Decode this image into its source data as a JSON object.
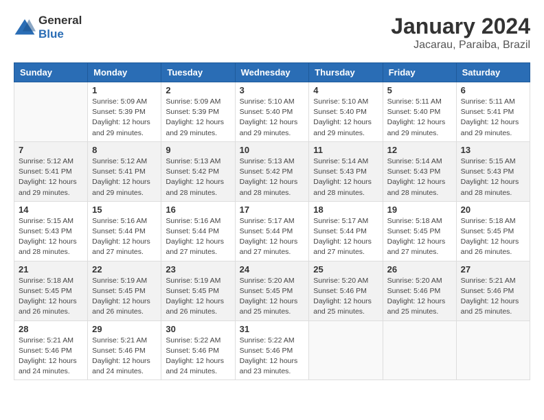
{
  "logo": {
    "text_general": "General",
    "text_blue": "Blue"
  },
  "title": "January 2024",
  "subtitle": "Jacarau, Paraiba, Brazil",
  "days_of_week": [
    "Sunday",
    "Monday",
    "Tuesday",
    "Wednesday",
    "Thursday",
    "Friday",
    "Saturday"
  ],
  "weeks": [
    [
      {
        "day": "",
        "info": ""
      },
      {
        "day": "1",
        "info": "Sunrise: 5:09 AM\nSunset: 5:39 PM\nDaylight: 12 hours\nand 29 minutes."
      },
      {
        "day": "2",
        "info": "Sunrise: 5:09 AM\nSunset: 5:39 PM\nDaylight: 12 hours\nand 29 minutes."
      },
      {
        "day": "3",
        "info": "Sunrise: 5:10 AM\nSunset: 5:40 PM\nDaylight: 12 hours\nand 29 minutes."
      },
      {
        "day": "4",
        "info": "Sunrise: 5:10 AM\nSunset: 5:40 PM\nDaylight: 12 hours\nand 29 minutes."
      },
      {
        "day": "5",
        "info": "Sunrise: 5:11 AM\nSunset: 5:40 PM\nDaylight: 12 hours\nand 29 minutes."
      },
      {
        "day": "6",
        "info": "Sunrise: 5:11 AM\nSunset: 5:41 PM\nDaylight: 12 hours\nand 29 minutes."
      }
    ],
    [
      {
        "day": "7",
        "info": "Sunrise: 5:12 AM\nSunset: 5:41 PM\nDaylight: 12 hours\nand 29 minutes."
      },
      {
        "day": "8",
        "info": "Sunrise: 5:12 AM\nSunset: 5:41 PM\nDaylight: 12 hours\nand 29 minutes."
      },
      {
        "day": "9",
        "info": "Sunrise: 5:13 AM\nSunset: 5:42 PM\nDaylight: 12 hours\nand 28 minutes."
      },
      {
        "day": "10",
        "info": "Sunrise: 5:13 AM\nSunset: 5:42 PM\nDaylight: 12 hours\nand 28 minutes."
      },
      {
        "day": "11",
        "info": "Sunrise: 5:14 AM\nSunset: 5:43 PM\nDaylight: 12 hours\nand 28 minutes."
      },
      {
        "day": "12",
        "info": "Sunrise: 5:14 AM\nSunset: 5:43 PM\nDaylight: 12 hours\nand 28 minutes."
      },
      {
        "day": "13",
        "info": "Sunrise: 5:15 AM\nSunset: 5:43 PM\nDaylight: 12 hours\nand 28 minutes."
      }
    ],
    [
      {
        "day": "14",
        "info": "Sunrise: 5:15 AM\nSunset: 5:43 PM\nDaylight: 12 hours\nand 28 minutes."
      },
      {
        "day": "15",
        "info": "Sunrise: 5:16 AM\nSunset: 5:44 PM\nDaylight: 12 hours\nand 27 minutes."
      },
      {
        "day": "16",
        "info": "Sunrise: 5:16 AM\nSunset: 5:44 PM\nDaylight: 12 hours\nand 27 minutes."
      },
      {
        "day": "17",
        "info": "Sunrise: 5:17 AM\nSunset: 5:44 PM\nDaylight: 12 hours\nand 27 minutes."
      },
      {
        "day": "18",
        "info": "Sunrise: 5:17 AM\nSunset: 5:44 PM\nDaylight: 12 hours\nand 27 minutes."
      },
      {
        "day": "19",
        "info": "Sunrise: 5:18 AM\nSunset: 5:45 PM\nDaylight: 12 hours\nand 27 minutes."
      },
      {
        "day": "20",
        "info": "Sunrise: 5:18 AM\nSunset: 5:45 PM\nDaylight: 12 hours\nand 26 minutes."
      }
    ],
    [
      {
        "day": "21",
        "info": "Sunrise: 5:18 AM\nSunset: 5:45 PM\nDaylight: 12 hours\nand 26 minutes."
      },
      {
        "day": "22",
        "info": "Sunrise: 5:19 AM\nSunset: 5:45 PM\nDaylight: 12 hours\nand 26 minutes."
      },
      {
        "day": "23",
        "info": "Sunrise: 5:19 AM\nSunset: 5:45 PM\nDaylight: 12 hours\nand 26 minutes."
      },
      {
        "day": "24",
        "info": "Sunrise: 5:20 AM\nSunset: 5:45 PM\nDaylight: 12 hours\nand 25 minutes."
      },
      {
        "day": "25",
        "info": "Sunrise: 5:20 AM\nSunset: 5:46 PM\nDaylight: 12 hours\nand 25 minutes."
      },
      {
        "day": "26",
        "info": "Sunrise: 5:20 AM\nSunset: 5:46 PM\nDaylight: 12 hours\nand 25 minutes."
      },
      {
        "day": "27",
        "info": "Sunrise: 5:21 AM\nSunset: 5:46 PM\nDaylight: 12 hours\nand 25 minutes."
      }
    ],
    [
      {
        "day": "28",
        "info": "Sunrise: 5:21 AM\nSunset: 5:46 PM\nDaylight: 12 hours\nand 24 minutes."
      },
      {
        "day": "29",
        "info": "Sunrise: 5:21 AM\nSunset: 5:46 PM\nDaylight: 12 hours\nand 24 minutes."
      },
      {
        "day": "30",
        "info": "Sunrise: 5:22 AM\nSunset: 5:46 PM\nDaylight: 12 hours\nand 24 minutes."
      },
      {
        "day": "31",
        "info": "Sunrise: 5:22 AM\nSunset: 5:46 PM\nDaylight: 12 hours\nand 23 minutes."
      },
      {
        "day": "",
        "info": ""
      },
      {
        "day": "",
        "info": ""
      },
      {
        "day": "",
        "info": ""
      }
    ]
  ]
}
